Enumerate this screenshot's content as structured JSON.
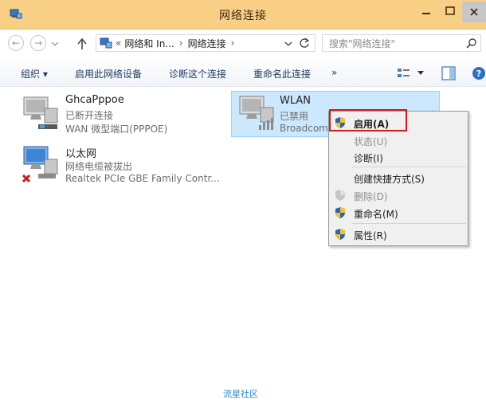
{
  "window": {
    "title": "网络连接"
  },
  "address": {
    "segment1": "网络和 In...",
    "segment2": "网络连接",
    "sep": "›",
    "overflow": "«"
  },
  "search": {
    "placeholder": "搜索\"网络连接\""
  },
  "toolbar": {
    "organize": "组织 ▾",
    "enable_device": "启用此网络设备",
    "diagnose": "诊断这个连接",
    "rename": "重命名此连接",
    "more": "»"
  },
  "connections": [
    {
      "name": "GhcaPppoe",
      "status": "已断开连接",
      "device": "WAN 微型端口(PPPOE)"
    },
    {
      "name": "以太网",
      "status": "网络电缆被拔出",
      "device": "Realtek PCIe GBE Family Contr..."
    },
    {
      "name": "WLAN",
      "status": "已禁用",
      "device": "Broadcom"
    }
  ],
  "context_menu": {
    "items": [
      {
        "label": "启用(A)"
      },
      {
        "label": "状态(U)"
      },
      {
        "label": "诊断(I)"
      },
      {
        "label": "创建快捷方式(S)"
      },
      {
        "label": "删除(D)"
      },
      {
        "label": "重命名(M)"
      },
      {
        "label": "属性(R)"
      }
    ]
  },
  "watermark": "流星社区",
  "colors": {
    "titlebar": "#f9cf86",
    "selection": "#cce8ff",
    "highlight_border": "#d11a1a"
  }
}
